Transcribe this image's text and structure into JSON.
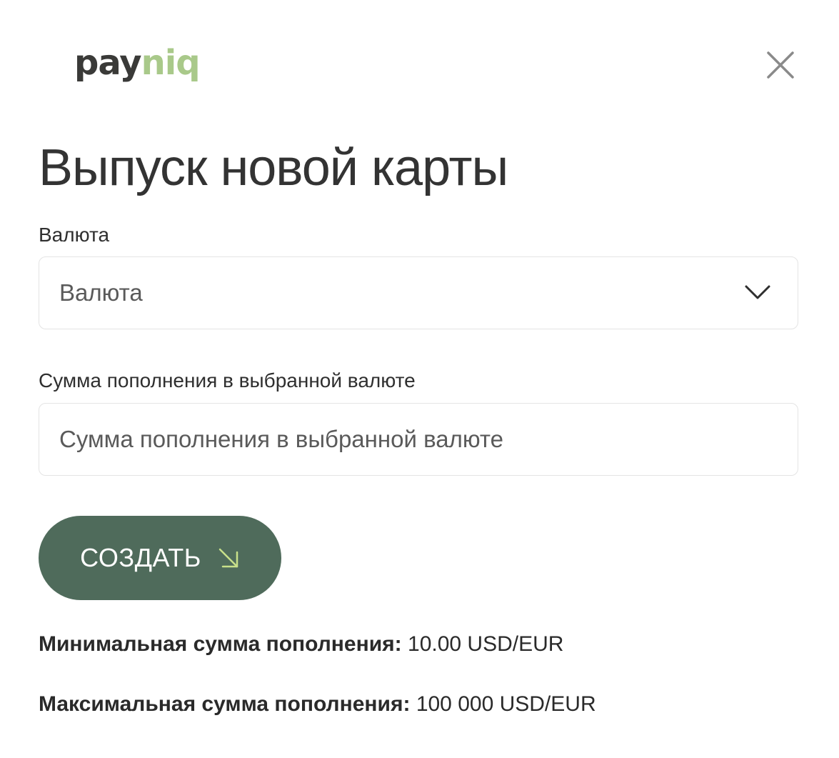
{
  "brand": {
    "logo_part1": "pay",
    "logo_part2": "niq",
    "logo_colors": {
      "dark": "#3a3a38",
      "accent": "#a9c98a"
    }
  },
  "header": {
    "close_icon": "close-icon"
  },
  "title": "Выпуск новой карты",
  "form": {
    "currency": {
      "label": "Валюта",
      "placeholder": "Валюта",
      "icon": "chevron-down-icon"
    },
    "amount": {
      "label": "Сумма пополнения в выбранной валюте",
      "placeholder": "Сумма пополнения в выбранной валюте"
    },
    "submit": {
      "label": "СОЗДАТЬ",
      "icon": "arrow-down-right-icon",
      "color": "#4f6b5b",
      "icon_color": "#c8e08a"
    }
  },
  "limits": {
    "min_label": "Минимальная сумма пополнения:",
    "min_value": "10.00 USD/EUR",
    "max_label": "Максимальная сумма пополнения:",
    "max_value": "100 000 USD/EUR"
  }
}
